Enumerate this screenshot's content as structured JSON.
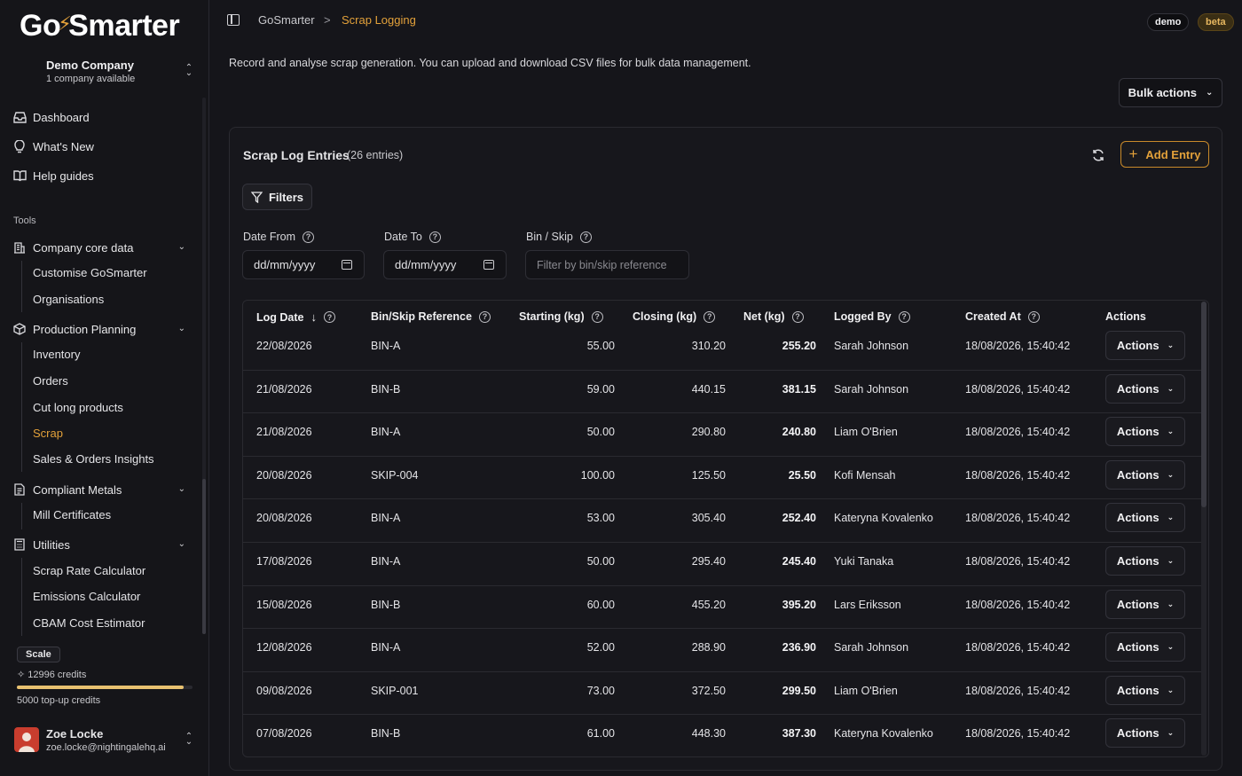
{
  "brand": {
    "logo_left": "Go",
    "logo_right": "Smarter"
  },
  "company": {
    "name": "Demo Company",
    "sub": "1 company available"
  },
  "nav": {
    "dashboard": "Dashboard",
    "whats_new": "What's New",
    "help_guides": "Help guides",
    "tools_label": "Tools",
    "company_core": "Company core data",
    "customise": "Customise GoSmarter",
    "organisations": "Organisations",
    "production_planning": "Production Planning",
    "inventory": "Inventory",
    "orders": "Orders",
    "cut_long": "Cut long products",
    "scrap": "Scrap",
    "sales_insights": "Sales & Orders Insights",
    "compliant_metals": "Compliant Metals",
    "mill_certs": "Mill Certificates",
    "utilities": "Utilities",
    "scrap_rate": "Scrap Rate Calculator",
    "emissions": "Emissions Calculator",
    "cbam": "CBAM Cost Estimator"
  },
  "plan": {
    "badge": "Scale",
    "credits": "12996 credits",
    "credit_fraction": 0.95,
    "topup": "5000 top-up credits"
  },
  "user": {
    "name": "Zoe Locke",
    "email": "zoe.locke@nightingalehq.ai"
  },
  "header": {
    "breadcrumb_home": "GoSmarter",
    "breadcrumb_sep": ">",
    "breadcrumb_current": "Scrap Logging",
    "pill_demo": "demo",
    "pill_beta": "beta",
    "description": "Record and analyse scrap generation. You can upload and download CSV files for bulk data management.",
    "bulk_actions": "Bulk actions"
  },
  "card": {
    "title": "Scrap Log Entries",
    "count": "(26 entries)",
    "add_entry": "Add Entry",
    "filters": "Filters"
  },
  "filters": {
    "date_from_label": "Date From",
    "date_from_value": "dd/mm/yyyy",
    "date_to_label": "Date To",
    "date_to_value": "dd/mm/yyyy",
    "bin_label": "Bin / Skip",
    "bin_placeholder": "Filter by bin/skip reference"
  },
  "table": {
    "headers": {
      "log_date": "Log Date",
      "bin": "Bin/Skip Reference",
      "starting": "Starting (kg)",
      "closing": "Closing (kg)",
      "net": "Net (kg)",
      "logged_by": "Logged By",
      "created_at": "Created At",
      "actions": "Actions"
    },
    "action_label": "Actions",
    "rows": [
      {
        "date": "22/08/2026",
        "bin": "BIN-A",
        "start": "55.00",
        "close": "310.20",
        "net": "255.20",
        "by": "Sarah Johnson",
        "created": "18/08/2026, 15:40:42"
      },
      {
        "date": "21/08/2026",
        "bin": "BIN-B",
        "start": "59.00",
        "close": "440.15",
        "net": "381.15",
        "by": "Sarah Johnson",
        "created": "18/08/2026, 15:40:42"
      },
      {
        "date": "21/08/2026",
        "bin": "BIN-A",
        "start": "50.00",
        "close": "290.80",
        "net": "240.80",
        "by": "Liam O'Brien",
        "created": "18/08/2026, 15:40:42"
      },
      {
        "date": "20/08/2026",
        "bin": "SKIP-004",
        "start": "100.00",
        "close": "125.50",
        "net": "25.50",
        "by": "Kofi Mensah",
        "created": "18/08/2026, 15:40:42"
      },
      {
        "date": "20/08/2026",
        "bin": "BIN-A",
        "start": "53.00",
        "close": "305.40",
        "net": "252.40",
        "by": "Kateryna Kovalenko",
        "created": "18/08/2026, 15:40:42"
      },
      {
        "date": "17/08/2026",
        "bin": "BIN-A",
        "start": "50.00",
        "close": "295.40",
        "net": "245.40",
        "by": "Yuki Tanaka",
        "created": "18/08/2026, 15:40:42"
      },
      {
        "date": "15/08/2026",
        "bin": "BIN-B",
        "start": "60.00",
        "close": "455.20",
        "net": "395.20",
        "by": "Lars Eriksson",
        "created": "18/08/2026, 15:40:42"
      },
      {
        "date": "12/08/2026",
        "bin": "BIN-A",
        "start": "52.00",
        "close": "288.90",
        "net": "236.90",
        "by": "Sarah Johnson",
        "created": "18/08/2026, 15:40:42"
      },
      {
        "date": "09/08/2026",
        "bin": "SKIP-001",
        "start": "73.00",
        "close": "372.50",
        "net": "299.50",
        "by": "Liam O'Brien",
        "created": "18/08/2026, 15:40:42"
      },
      {
        "date": "07/08/2026",
        "bin": "BIN-B",
        "start": "61.00",
        "close": "448.30",
        "net": "387.30",
        "by": "Kateryna Kovalenko",
        "created": "18/08/2026, 15:40:42"
      }
    ]
  },
  "colors": {
    "accent": "#e3a13a",
    "background": "#15151a",
    "card": "#17171c",
    "border": "#2a2a30"
  },
  "icons": [
    "dashboard-icon",
    "lightbulb-icon",
    "book-icon",
    "building-icon",
    "box-icon",
    "document-icon",
    "calculator-icon",
    "sparkle-icon",
    "refresh-icon",
    "plus-icon",
    "filter-icon",
    "help-icon",
    "calendar-icon",
    "sort-down-icon",
    "chevron-down-icon"
  ]
}
